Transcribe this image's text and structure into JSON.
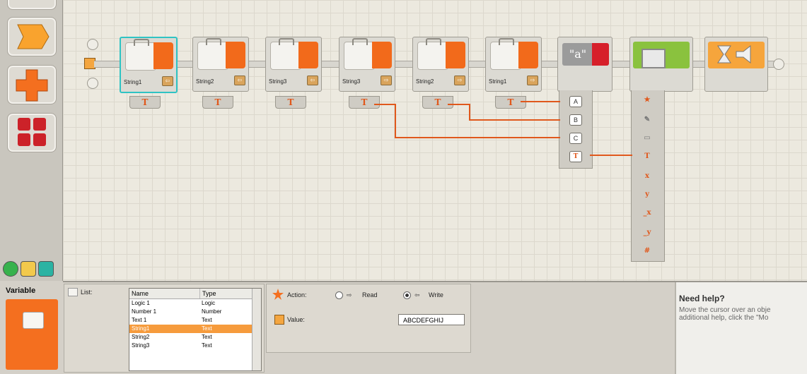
{
  "colors": {
    "accent_orange": "#f26a1b",
    "selection": "#2fc3c3",
    "wire": "#e0581c"
  },
  "palette": {
    "icons": [
      "flow-shape-icon",
      "plus-shape-icon",
      "grid-shape-icon"
    ],
    "tabs": [
      "common-tab-icon",
      "complete-tab-icon",
      "custom-tab-icon"
    ]
  },
  "blocks": [
    {
      "label": "String1",
      "mode": "write"
    },
    {
      "label": "String2",
      "mode": "write"
    },
    {
      "label": "String3",
      "mode": "write"
    },
    {
      "label": "String3",
      "mode": "read"
    },
    {
      "label": "String2",
      "mode": "read"
    },
    {
      "label": "String1",
      "mode": "read"
    }
  ],
  "text_block": {
    "caption": "\"a\"",
    "plugs": [
      "A",
      "B",
      "C"
    ]
  },
  "display_block": {
    "plug_glyphs": [
      "T",
      "x",
      "y",
      "_x",
      "_y",
      "#"
    ]
  },
  "bottom": {
    "title": "Variable",
    "list_label": "List:",
    "columns": [
      "Name",
      "Type"
    ],
    "rows": [
      [
        "Logic 1",
        "Logic"
      ],
      [
        "Number 1",
        "Number"
      ],
      [
        "Text 1",
        "Text"
      ],
      [
        "String1",
        "Text"
      ],
      [
        "String2",
        "Text"
      ],
      [
        "String3",
        "Text"
      ]
    ],
    "selected_row": 3,
    "action_label": "Action:",
    "read_label": "Read",
    "write_label": "Write",
    "value_label": "Value:",
    "value": "ABCDEFGHIJ"
  },
  "help": {
    "title": "Need help?",
    "line1": "Move the cursor over an obje",
    "line2": "additional help, click the \"Mo"
  }
}
